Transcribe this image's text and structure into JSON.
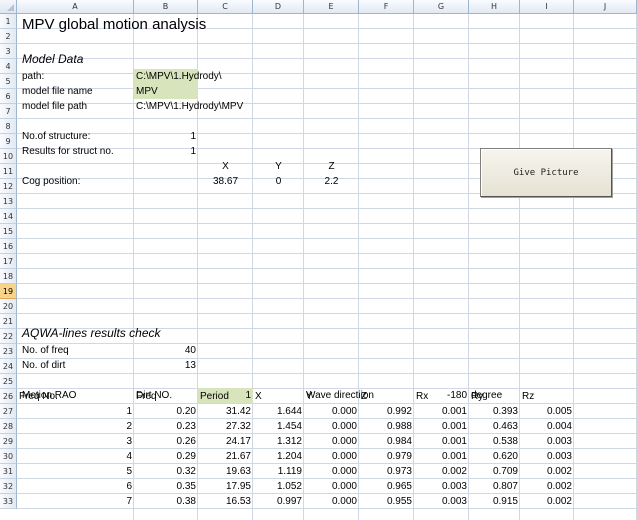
{
  "columns": [
    "A",
    "B",
    "C",
    "D",
    "E",
    "F",
    "G",
    "H",
    "I",
    "J"
  ],
  "rows": [
    "1",
    "2",
    "3",
    "4",
    "5",
    "6",
    "7",
    "8",
    "9",
    "10",
    "11",
    "12",
    "13",
    "14",
    "15",
    "16",
    "17",
    "18",
    "19",
    "20",
    "21",
    "22",
    "23",
    "24",
    "25",
    "26",
    "27",
    "28",
    "29",
    "30",
    "31",
    "32",
    "33"
  ],
  "selected_row": "19",
  "title": "MPV global motion analysis",
  "model": {
    "heading": "Model Data",
    "path_label": "path:",
    "path_value": "C:\\MPV\\1.Hydrody\\",
    "file_name_label": "model file name",
    "file_name_value": "MPV",
    "file_path_label": "model file path",
    "file_path_value": "C:\\MPV\\1.Hydrody\\MPV"
  },
  "structure": {
    "count_label": "No.of structure:",
    "count_value": "1",
    "results_label": "Results for struct no.",
    "results_value": "1"
  },
  "cog": {
    "x_header": "X",
    "y_header": "Y",
    "z_header": "Z",
    "label": "Cog position:",
    "x": "38.67",
    "y": "0",
    "z": "2.2"
  },
  "button": {
    "label": "Give Picture"
  },
  "aqwa": {
    "heading": "AQWA-lines results check",
    "freq_label": "No. of freq",
    "freq_value": "40",
    "dirt_label": "No. of dirt",
    "dirt_value": "13"
  },
  "rao": {
    "label": "Motion RAO",
    "dirt_label": "Dirt NO.",
    "dirt_value": "1",
    "wave_label": "Wave directiion",
    "wave_value": "-180",
    "wave_unit": "degree",
    "headers": [
      "Freq No.",
      "Freq",
      "Period",
      "X",
      "Y",
      "Z",
      "Rx",
      "Ry",
      "Rz"
    ],
    "rows": [
      [
        "1",
        "0.20",
        "31.42",
        "1.644",
        "0.000",
        "0.992",
        "0.001",
        "0.393",
        "0.005"
      ],
      [
        "2",
        "0.23",
        "27.32",
        "1.454",
        "0.000",
        "0.988",
        "0.001",
        "0.463",
        "0.004"
      ],
      [
        "3",
        "0.26",
        "24.17",
        "1.312",
        "0.000",
        "0.984",
        "0.001",
        "0.538",
        "0.003"
      ],
      [
        "4",
        "0.29",
        "21.67",
        "1.204",
        "0.000",
        "0.979",
        "0.001",
        "0.620",
        "0.003"
      ],
      [
        "5",
        "0.32",
        "19.63",
        "1.119",
        "0.000",
        "0.973",
        "0.002",
        "0.709",
        "0.002"
      ],
      [
        "6",
        "0.35",
        "17.95",
        "1.052",
        "0.000",
        "0.965",
        "0.003",
        "0.807",
        "0.002"
      ],
      [
        "7",
        "0.38",
        "16.53",
        "0.997",
        "0.000",
        "0.955",
        "0.003",
        "0.915",
        "0.002"
      ]
    ]
  }
}
